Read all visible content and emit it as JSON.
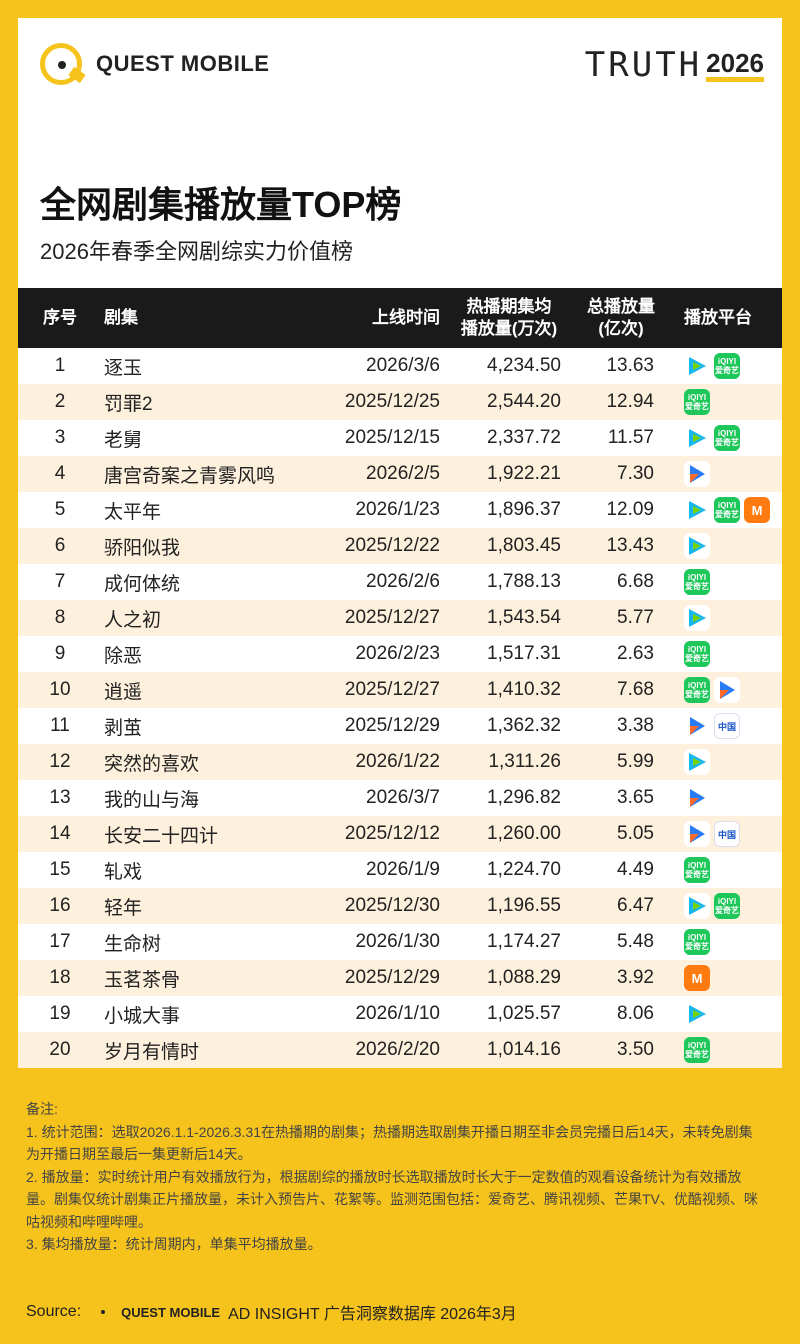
{
  "header": {
    "brand": "QUEST MOBILE",
    "truth_word": "TRUTH",
    "truth_year": "2026",
    "title": "全网剧集播放量TOP榜",
    "subtitle": "2026年春季全网剧综实力价值榜"
  },
  "table": {
    "columns": {
      "rank": "序号",
      "name": "剧集",
      "date": "上线时间",
      "avg_line1": "热播期集均",
      "avg_line2": "播放量(万次)",
      "total_line1": "总播放量",
      "total_line2": "(亿次)",
      "platform": "播放平台"
    },
    "rows": [
      {
        "rank": "1",
        "name": "逐玉",
        "date": "2026/3/6",
        "avg": "4,234.50",
        "total": "13.63",
        "platforms": [
          "tencent",
          "iqiyi"
        ]
      },
      {
        "rank": "2",
        "name": "罚罪2",
        "date": "2025/12/25",
        "avg": "2,544.20",
        "total": "12.94",
        "platforms": [
          "iqiyi"
        ]
      },
      {
        "rank": "3",
        "name": "老舅",
        "date": "2025/12/15",
        "avg": "2,337.72",
        "total": "11.57",
        "platforms": [
          "tencent",
          "iqiyi"
        ]
      },
      {
        "rank": "4",
        "name": "唐宫奇案之青雾风鸣",
        "date": "2026/2/5",
        "avg": "1,922.21",
        "total": "7.30",
        "platforms": [
          "youku"
        ]
      },
      {
        "rank": "5",
        "name": "太平年",
        "date": "2026/1/23",
        "avg": "1,896.37",
        "total": "12.09",
        "platforms": [
          "tencent",
          "iqiyi",
          "mango"
        ]
      },
      {
        "rank": "6",
        "name": "骄阳似我",
        "date": "2025/12/22",
        "avg": "1,803.45",
        "total": "13.43",
        "platforms": [
          "tencent"
        ]
      },
      {
        "rank": "7",
        "name": "成何体统",
        "date": "2026/2/6",
        "avg": "1,788.13",
        "total": "6.68",
        "platforms": [
          "iqiyi"
        ]
      },
      {
        "rank": "8",
        "name": "人之初",
        "date": "2025/12/27",
        "avg": "1,543.54",
        "total": "5.77",
        "platforms": [
          "tencent"
        ]
      },
      {
        "rank": "9",
        "name": "除恶",
        "date": "2026/2/23",
        "avg": "1,517.31",
        "total": "2.63",
        "platforms": [
          "iqiyi"
        ]
      },
      {
        "rank": "10",
        "name": "逍遥",
        "date": "2025/12/27",
        "avg": "1,410.32",
        "total": "7.68",
        "platforms": [
          "iqiyi",
          "youku"
        ]
      },
      {
        "rank": "11",
        "name": "剥茧",
        "date": "2025/12/29",
        "avg": "1,362.32",
        "total": "3.38",
        "platforms": [
          "youku",
          "migu"
        ]
      },
      {
        "rank": "12",
        "name": "突然的喜欢",
        "date": "2026/1/22",
        "avg": "1,311.26",
        "total": "5.99",
        "platforms": [
          "tencent"
        ]
      },
      {
        "rank": "13",
        "name": "我的山与海",
        "date": "2026/3/7",
        "avg": "1,296.82",
        "total": "3.65",
        "platforms": [
          "youku"
        ]
      },
      {
        "rank": "14",
        "name": "长安二十四计",
        "date": "2025/12/12",
        "avg": "1,260.00",
        "total": "5.05",
        "platforms": [
          "youku",
          "migu"
        ]
      },
      {
        "rank": "15",
        "name": "轧戏",
        "date": "2026/1/9",
        "avg": "1,224.70",
        "total": "4.49",
        "platforms": [
          "iqiyi"
        ]
      },
      {
        "rank": "16",
        "name": "轻年",
        "date": "2025/12/30",
        "avg": "1,196.55",
        "total": "6.47",
        "platforms": [
          "tencent",
          "iqiyi"
        ]
      },
      {
        "rank": "17",
        "name": "生命树",
        "date": "2026/1/30",
        "avg": "1,174.27",
        "total": "5.48",
        "platforms": [
          "iqiyi"
        ]
      },
      {
        "rank": "18",
        "name": "玉茗茶骨",
        "date": "2025/12/29",
        "avg": "1,088.29",
        "total": "3.92",
        "platforms": [
          "mango"
        ]
      },
      {
        "rank": "19",
        "name": "小城大事",
        "date": "2026/1/10",
        "avg": "1,025.57",
        "total": "8.06",
        "platforms": [
          "tencent"
        ]
      },
      {
        "rank": "20",
        "name": "岁月有情时",
        "date": "2026/2/20",
        "avg": "1,014.16",
        "total": "3.50",
        "platforms": [
          "iqiyi"
        ]
      }
    ]
  },
  "icon_text": {
    "iqiyi_top": "iQIYI",
    "iqiyi_bottom": "爱奇艺",
    "mango": "M",
    "migu": "中国"
  },
  "notes": {
    "heading": "备注:",
    "n1": "1. 统计范围：选取2026.1.1-2026.3.31在热播期的剧集；热播期选取剧集开播日期至非会员完播日后14天，未转免剧集为开播日期至最后一集更新后14天。",
    "n2": "2. 播放量：实时统计用户有效播放行为，根据剧综的播放时长选取播放时长大于一定数值的观看设备统计为有效播放量。剧集仅统计剧集正片播放量，未计入预告片、花絮等。监测范围包括：爱奇艺、腾讯视频、芒果TV、优酷视频、咪咕视频和哔哩哔哩。",
    "n3": "3. 集均播放量：统计周期内，单集平均播放量。"
  },
  "source": {
    "label": "Source:",
    "brand": "QUEST MOBILE",
    "text": "AD INSIGHT 广告洞察数据库 2026年3月"
  },
  "colors": {
    "accent_yellow": "#f5c31c",
    "header_black": "#1a1a1a",
    "stripe": "#fdf0dc"
  }
}
